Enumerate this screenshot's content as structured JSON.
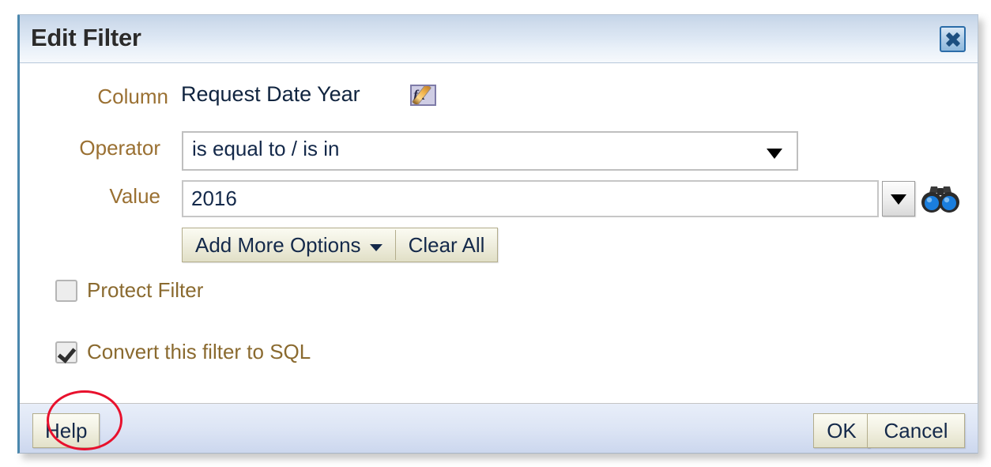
{
  "dialog": {
    "title": "Edit Filter",
    "close_icon": "close-icon",
    "accent_border_color": "#4a87ad",
    "titlebar_gradient_from": "#c3d4e8",
    "titlebar_gradient_to": "#f6f9fc",
    "body_background": "#ffffff",
    "footer_background": "#dde5f5"
  },
  "form": {
    "column": {
      "label": "Column",
      "value": "Request Date Year",
      "edit_formula_icon": "fx-edit-icon",
      "edit_formula_text": "fx"
    },
    "operator": {
      "label": "Operator",
      "value": "is equal to / is in",
      "caret_icon": "chevron-down-icon"
    },
    "value": {
      "label": "Value",
      "value": "2016",
      "placeholder": "",
      "dropdown_icon": "chevron-down-icon",
      "search_icon": "binoculars-icon"
    },
    "options": {
      "add_more_options_label": "Add More Options",
      "add_more_options_caret": "chevron-down-icon",
      "clear_all_label": "Clear All"
    },
    "checkboxes": [
      {
        "label": "Protect Filter",
        "checked": false,
        "name": "protect-filter-checkbox"
      },
      {
        "label": "Convert this filter to SQL",
        "checked": true,
        "name": "convert-to-sql-checkbox"
      }
    ]
  },
  "annotation": {
    "shape": "ellipse",
    "color": "#e8112d",
    "targets": "convert-to-sql-checkbox"
  },
  "footer": {
    "help_label": "Help",
    "ok_label": "OK",
    "cancel_label": "Cancel"
  },
  "label_color": "#9a7032",
  "value_text_color": "#14294a"
}
